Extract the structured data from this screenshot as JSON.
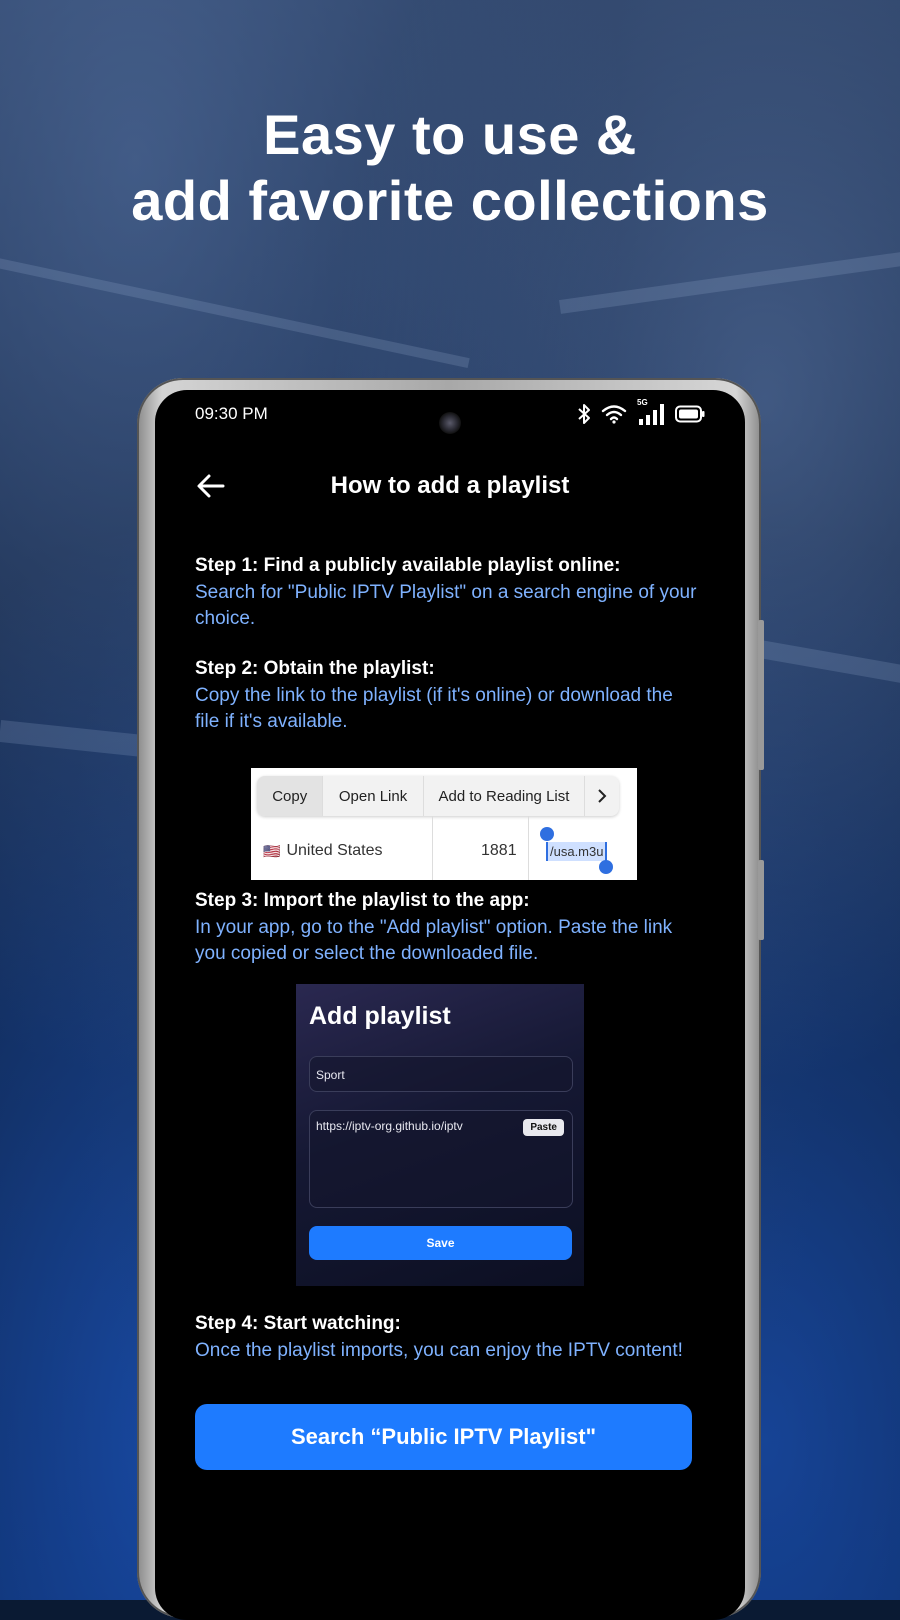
{
  "headline": {
    "line1": "Easy to use &",
    "line2": "add favorite collections"
  },
  "status_bar": {
    "time": "09:30 PM",
    "network": "5G",
    "icons": [
      "bluetooth-icon",
      "wifi-icon",
      "signal-icon",
      "battery-icon"
    ]
  },
  "app_bar": {
    "title": "How to add a playlist",
    "back_icon": "arrow-left-icon"
  },
  "steps": [
    {
      "title": "Step 1: Find a publicly available playlist online:",
      "text": "Search for \"Public IPTV Playlist\" on a search engine of your choice."
    },
    {
      "title": "Step 2: Obtain the playlist:",
      "text": "Copy the link to the playlist (if it's online) or download the file if it's available."
    },
    {
      "title": "Step 3: Import the playlist to the app:",
      "text": "In your app, go to the \"Add playlist\" option. Paste the link you copied or select the downloaded file."
    },
    {
      "title": "Step 4: Start watching:",
      "text": "Once the playlist imports, you can enjoy the IPTV content!"
    }
  ],
  "context_menu_example": {
    "items": [
      "Copy",
      "Open Link",
      "Add to Reading List"
    ],
    "more_icon": "chevron-right-icon",
    "row": {
      "flag": "🇺🇸",
      "country": "United States",
      "count": "1881",
      "selection": "/usa.m3u"
    }
  },
  "add_playlist_example": {
    "title": "Add playlist",
    "name_value": "Sport",
    "url_value": "https://iptv-org.github.io/iptv",
    "paste_label": "Paste",
    "save_label": "Save"
  },
  "cta": {
    "label": "Search “Public IPTV Playlist\""
  },
  "colors": {
    "accent": "#1e7bff",
    "step_text": "#7fb2ff",
    "screen_bg": "#000000"
  }
}
